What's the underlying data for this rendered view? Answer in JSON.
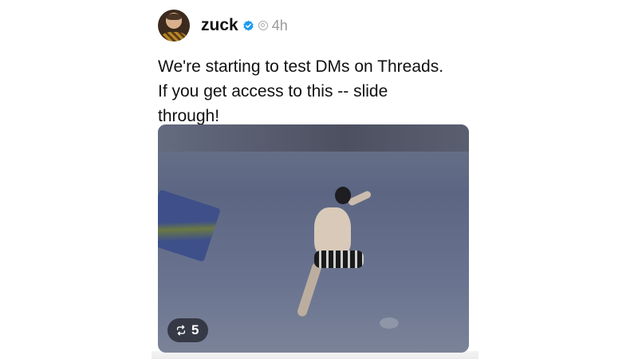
{
  "post": {
    "username": "zuck",
    "time": "4h",
    "text": "We're starting to test DMs on Threads.\nIf you get access to this -- slide\nthrough!",
    "media": {
      "repost_count": "5"
    }
  },
  "icons": {
    "verified": "verified-badge-icon",
    "threads": "threads-logo-icon",
    "repost": "repost-icon"
  },
  "colors": {
    "verified_blue": "#1d9bf0",
    "meta_text": "#9a9a9a"
  }
}
